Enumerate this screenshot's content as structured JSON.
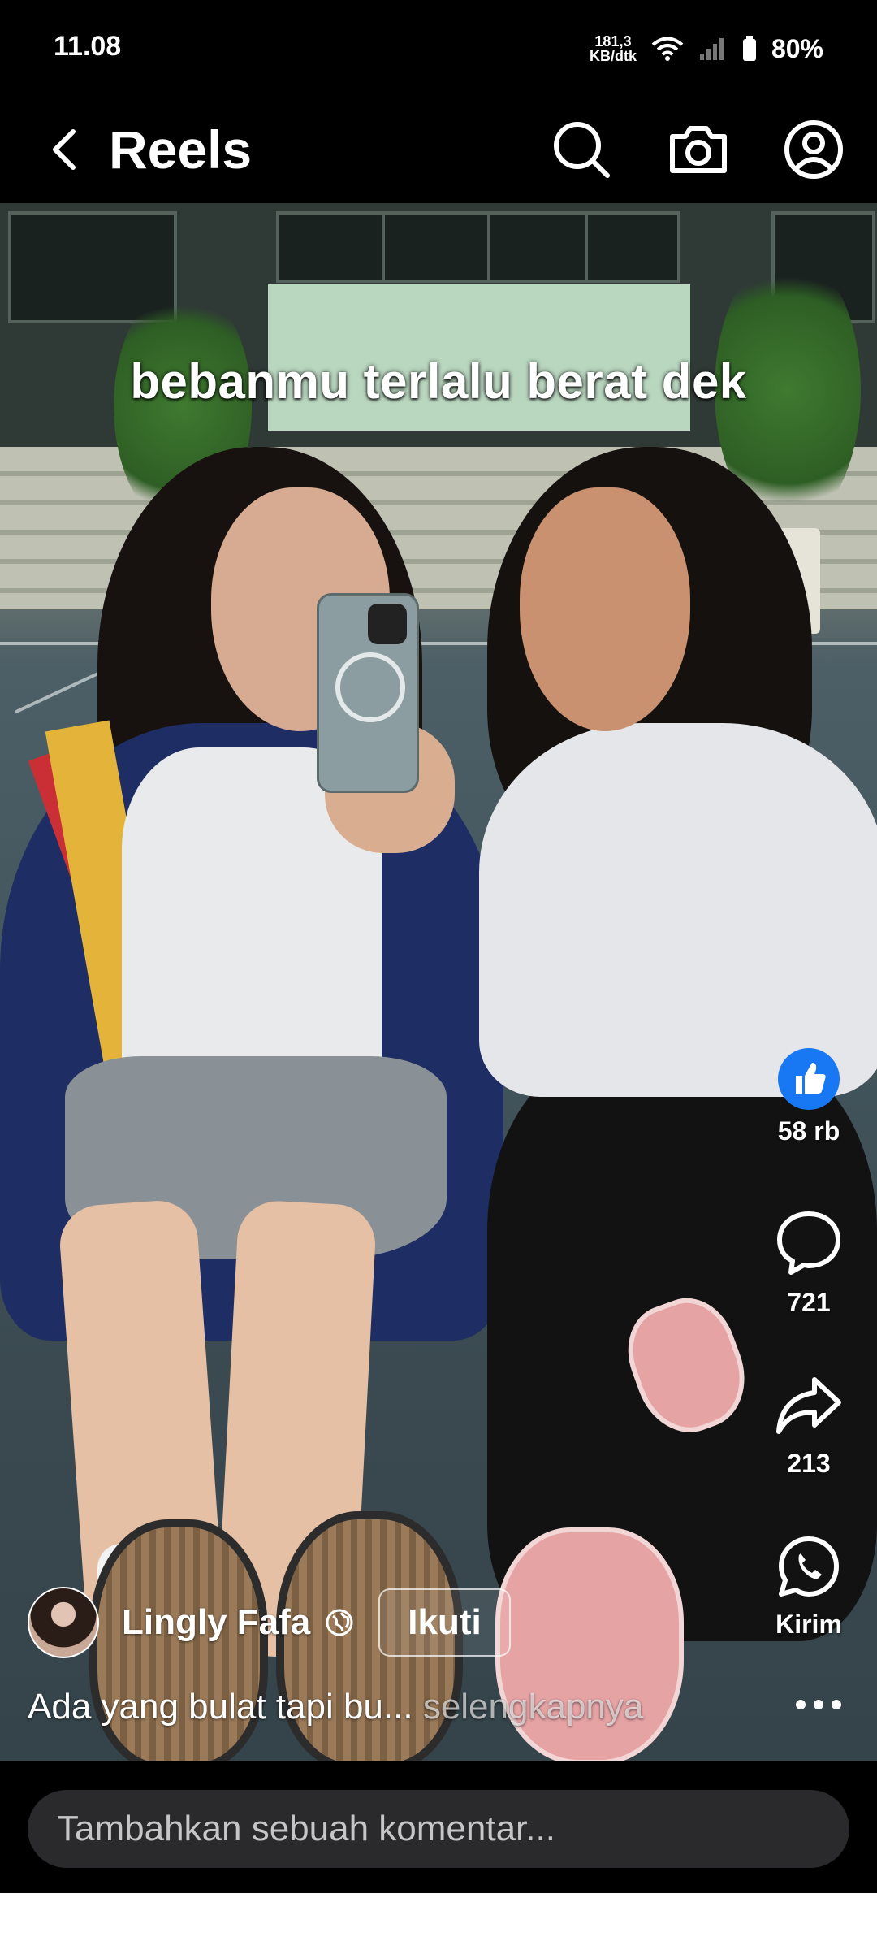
{
  "status_bar": {
    "time": "11.08",
    "net_speed_value": "181,3",
    "net_speed_unit": "KB/dtk",
    "battery": "80%"
  },
  "header": {
    "title": "Reels",
    "icons": [
      "back-icon",
      "search-icon",
      "camera-icon",
      "profile-icon"
    ]
  },
  "video": {
    "overlay_text": "bebanmu terlalu berat dek"
  },
  "actions": {
    "like_count": "58 rb",
    "comment_count": "721",
    "share_count": "213",
    "send_label": "Kirim"
  },
  "author": {
    "name": "Lingly Fafa",
    "follow_label": "Ikuti"
  },
  "description": {
    "text": "Ada yang bulat tapi bu...",
    "more_label": "selengkapnya"
  },
  "comment": {
    "placeholder": "Tambahkan sebuah komentar..."
  },
  "colors": {
    "like_blue": "#1877f2",
    "background": "#000000"
  }
}
